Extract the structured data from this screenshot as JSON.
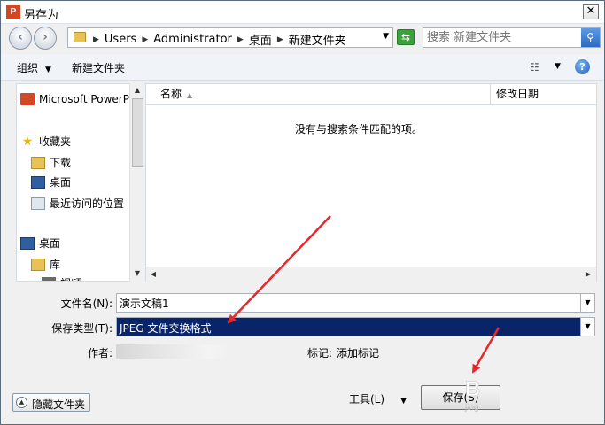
{
  "window": {
    "title": "另存为",
    "app_icon": "P",
    "close_label": "✕"
  },
  "address_bar": {
    "crumbs": [
      "Users",
      "Administrator",
      "桌面",
      "新建文件夹"
    ],
    "search_placeholder": "搜索 新建文件夹"
  },
  "toolbar": {
    "organize_label": "组织",
    "new_folder_label": "新建文件夹"
  },
  "nav_pane": {
    "items": [
      {
        "label": "Microsoft PowerP",
        "icon": "powerpoint-icon"
      },
      {
        "label": "收藏夹",
        "icon": "star-icon"
      },
      {
        "label": "下载",
        "icon": "download-folder-icon"
      },
      {
        "label": "桌面",
        "icon": "desktop-icon"
      },
      {
        "label": "最近访问的位置",
        "icon": "recent-places-icon"
      },
      {
        "label": "桌面",
        "icon": "desktop-icon"
      },
      {
        "label": "库",
        "icon": "library-icon"
      },
      {
        "label": "视频",
        "icon": "video-icon"
      }
    ]
  },
  "file_list": {
    "columns": [
      "名称",
      "修改日期"
    ],
    "empty_message": "没有与搜索条件匹配的项。"
  },
  "form": {
    "file_name_label": "文件名(N):",
    "file_name_value": "演示文稿1",
    "save_type_label": "保存类型(T):",
    "save_type_value": "JPEG 文件交换格式",
    "author_label": "作者:",
    "tags_label": "标记:",
    "tags_value": "添加标记"
  },
  "footer": {
    "hide_folders_label": "隐藏文件夹",
    "tools_label": "工具(L)",
    "save_label": "保存(S)"
  },
  "annotations": {
    "arrow_color": "#e8282a"
  }
}
